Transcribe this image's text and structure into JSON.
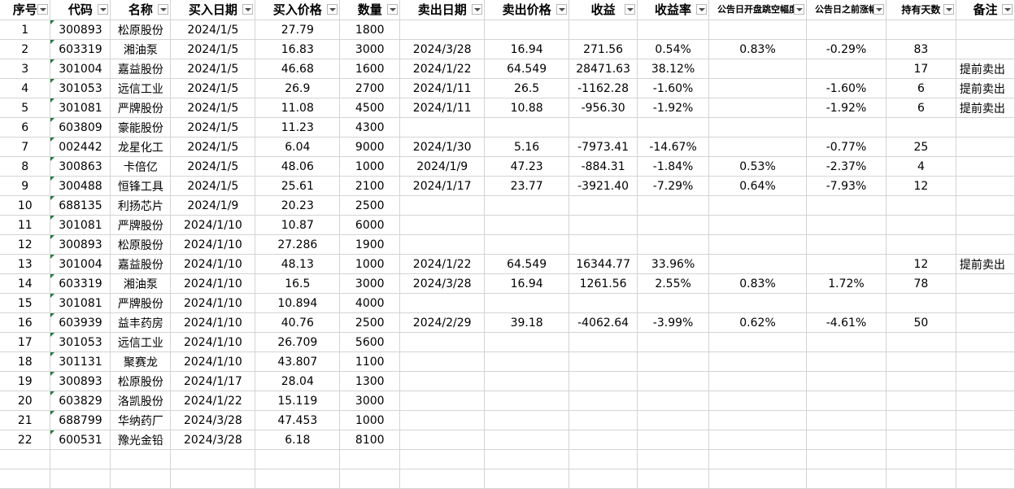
{
  "headers": [
    {
      "label": "序号",
      "filter": true
    },
    {
      "label": "代码",
      "filter": true
    },
    {
      "label": "名称",
      "filter": true
    },
    {
      "label": "买入日期",
      "filter": true
    },
    {
      "label": "买入价格",
      "filter": true
    },
    {
      "label": "数量",
      "filter": true
    },
    {
      "label": "卖出日期",
      "filter": true
    },
    {
      "label": "卖出价格",
      "filter": true
    },
    {
      "label": "收益",
      "filter": true
    },
    {
      "label": "收益率",
      "filter": true
    },
    {
      "label": "公告日开盘跳空幅度",
      "filter": true
    },
    {
      "label": "公告日之前涨幅",
      "filter": true
    },
    {
      "label": "持有天数",
      "filter": true
    },
    {
      "label": "备注",
      "filter": true
    }
  ],
  "rows": [
    [
      "1",
      "300893",
      "松原股份",
      "2024/1/5",
      "27.79",
      "1800",
      "",
      "",
      "",
      "",
      "",
      "",
      "",
      ""
    ],
    [
      "2",
      "603319",
      "湘油泵",
      "2024/1/5",
      "16.83",
      "3000",
      "2024/3/28",
      "16.94",
      "271.56",
      "0.54%",
      "0.83%",
      "-0.29%",
      "83",
      ""
    ],
    [
      "3",
      "301004",
      "嘉益股份",
      "2024/1/5",
      "46.68",
      "1600",
      "2024/1/22",
      "64.549",
      "28471.63",
      "38.12%",
      "",
      "",
      "17",
      "提前卖出"
    ],
    [
      "4",
      "301053",
      "远信工业",
      "2024/1/5",
      "26.9",
      "2700",
      "2024/1/11",
      "26.5",
      "-1162.28",
      "-1.60%",
      "",
      "-1.60%",
      "6",
      "提前卖出"
    ],
    [
      "5",
      "301081",
      "严牌股份",
      "2024/1/5",
      "11.08",
      "4500",
      "2024/1/11",
      "10.88",
      "-956.30",
      "-1.92%",
      "",
      "-1.92%",
      "6",
      "提前卖出"
    ],
    [
      "6",
      "603809",
      "豪能股份",
      "2024/1/5",
      "11.23",
      "4300",
      "",
      "",
      "",
      "",
      "",
      "",
      "",
      ""
    ],
    [
      "7",
      "002442",
      "龙星化工",
      "2024/1/5",
      "6.04",
      "9000",
      "2024/1/30",
      "5.16",
      "-7973.41",
      "-14.67%",
      "",
      "-0.77%",
      "25",
      ""
    ],
    [
      "8",
      "300863",
      "卡倍亿",
      "2024/1/5",
      "48.06",
      "1000",
      "2024/1/9",
      "47.23",
      "-884.31",
      "-1.84%",
      "0.53%",
      "-2.37%",
      "4",
      ""
    ],
    [
      "9",
      "300488",
      "恒锋工具",
      "2024/1/5",
      "25.61",
      "2100",
      "2024/1/17",
      "23.77",
      "-3921.40",
      "-7.29%",
      "0.64%",
      "-7.93%",
      "12",
      ""
    ],
    [
      "10",
      "688135",
      "利扬芯片",
      "2024/1/9",
      "20.23",
      "2500",
      "",
      "",
      "",
      "",
      "",
      "",
      "",
      ""
    ],
    [
      "11",
      "301081",
      "严牌股份",
      "2024/1/10",
      "10.87",
      "6000",
      "",
      "",
      "",
      "",
      "",
      "",
      "",
      ""
    ],
    [
      "12",
      "300893",
      "松原股份",
      "2024/1/10",
      "27.286",
      "1900",
      "",
      "",
      "",
      "",
      "",
      "",
      "",
      ""
    ],
    [
      "13",
      "301004",
      "嘉益股份",
      "2024/1/10",
      "48.13",
      "1000",
      "2024/1/22",
      "64.549",
      "16344.77",
      "33.96%",
      "",
      "",
      "12",
      "提前卖出"
    ],
    [
      "14",
      "603319",
      "湘油泵",
      "2024/1/10",
      "16.5",
      "3000",
      "2024/3/28",
      "16.94",
      "1261.56",
      "2.55%",
      "0.83%",
      "1.72%",
      "78",
      ""
    ],
    [
      "15",
      "301081",
      "严牌股份",
      "2024/1/10",
      "10.894",
      "4000",
      "",
      "",
      "",
      "",
      "",
      "",
      "",
      ""
    ],
    [
      "16",
      "603939",
      "益丰药房",
      "2024/1/10",
      "40.76",
      "2500",
      "2024/2/29",
      "39.18",
      "-4062.64",
      "-3.99%",
      "0.62%",
      "-4.61%",
      "50",
      ""
    ],
    [
      "17",
      "301053",
      "远信工业",
      "2024/1/10",
      "26.709",
      "5600",
      "",
      "",
      "",
      "",
      "",
      "",
      "",
      ""
    ],
    [
      "18",
      "301131",
      "聚赛龙",
      "2024/1/10",
      "43.807",
      "1100",
      "",
      "",
      "",
      "",
      "",
      "",
      "",
      ""
    ],
    [
      "19",
      "300893",
      "松原股份",
      "2024/1/17",
      "28.04",
      "1300",
      "",
      "",
      "",
      "",
      "",
      "",
      "",
      ""
    ],
    [
      "20",
      "603829",
      "洛凯股份",
      "2024/1/22",
      "15.119",
      "3000",
      "",
      "",
      "",
      "",
      "",
      "",
      "",
      ""
    ],
    [
      "21",
      "688799",
      "华纳药厂",
      "2024/3/28",
      "47.453",
      "1000",
      "",
      "",
      "",
      "",
      "",
      "",
      "",
      ""
    ],
    [
      "22",
      "600531",
      "豫光金铅",
      "2024/3/28",
      "6.18",
      "8100",
      "",
      "",
      "",
      "",
      "",
      "",
      "",
      ""
    ]
  ],
  "colors": {
    "grid": "#d4d4d4",
    "accent": "#1e7b3a",
    "filter_arrow": "#4a4a4a"
  },
  "icons": {
    "filter": "dropdown-filter-icon",
    "cell_marker": "green-triangle-icon"
  }
}
